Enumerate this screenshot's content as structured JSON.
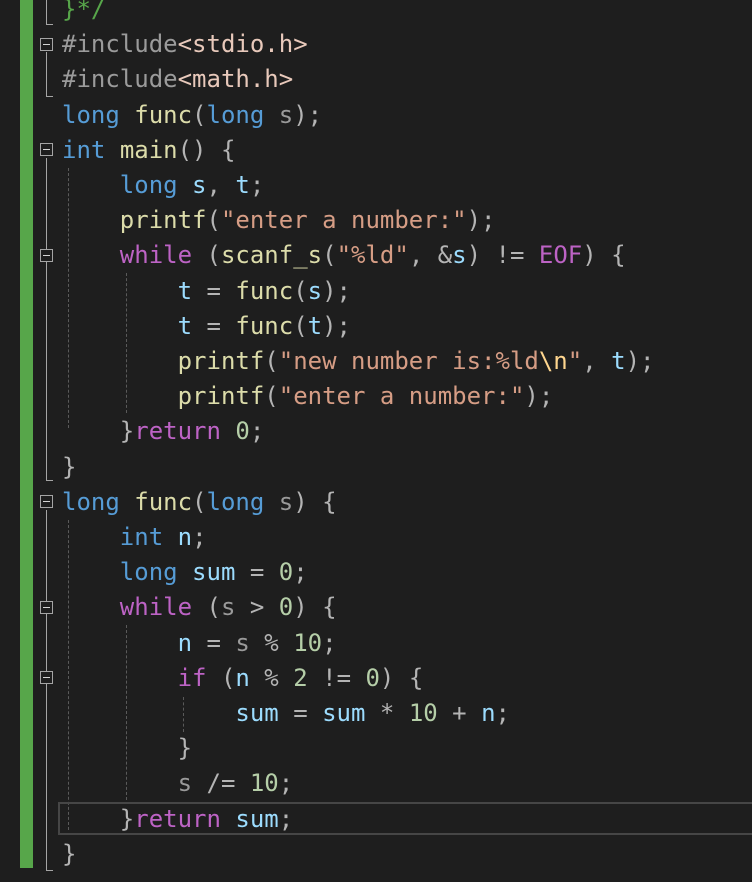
{
  "editor": {
    "lines": [
      [
        {
          "t": "}*/",
          "c": "cm"
        }
      ],
      [
        {
          "t": "#include",
          "c": "pp"
        },
        {
          "t": "<stdio.h>",
          "c": "hdr"
        }
      ],
      [
        {
          "t": "#include",
          "c": "pp"
        },
        {
          "t": "<math.h>",
          "c": "hdr"
        }
      ],
      [
        {
          "t": "long",
          "c": "kw"
        },
        {
          "t": " "
        },
        {
          "t": "func",
          "c": "fn"
        },
        {
          "t": "(",
          "c": "op"
        },
        {
          "t": "long",
          "c": "kw"
        },
        {
          "t": " "
        },
        {
          "t": "s",
          "c": "prm"
        },
        {
          "t": ");",
          "c": "op"
        }
      ],
      [
        {
          "t": "int",
          "c": "kw"
        },
        {
          "t": " "
        },
        {
          "t": "main",
          "c": "fn"
        },
        {
          "t": "() {",
          "c": "op"
        }
      ],
      [
        {
          "t": "    "
        },
        {
          "t": "long",
          "c": "kw"
        },
        {
          "t": " "
        },
        {
          "t": "s",
          "c": "var"
        },
        {
          "t": ", ",
          "c": "op"
        },
        {
          "t": "t",
          "c": "var"
        },
        {
          "t": ";",
          "c": "op"
        }
      ],
      [
        {
          "t": "    "
        },
        {
          "t": "printf",
          "c": "fn"
        },
        {
          "t": "(",
          "c": "op"
        },
        {
          "t": "\"enter a number:\"",
          "c": "str"
        },
        {
          "t": ");",
          "c": "op"
        }
      ],
      [
        {
          "t": "    "
        },
        {
          "t": "while",
          "c": "mac"
        },
        {
          "t": " (",
          "c": "op"
        },
        {
          "t": "scanf_s",
          "c": "fn"
        },
        {
          "t": "(",
          "c": "op"
        },
        {
          "t": "\"%ld\"",
          "c": "str"
        },
        {
          "t": ", &",
          "c": "op"
        },
        {
          "t": "s",
          "c": "var"
        },
        {
          "t": ") != ",
          "c": "op"
        },
        {
          "t": "EOF",
          "c": "mac"
        },
        {
          "t": ") {",
          "c": "op"
        }
      ],
      [
        {
          "t": "        "
        },
        {
          "t": "t",
          "c": "var"
        },
        {
          "t": " = ",
          "c": "op"
        },
        {
          "t": "func",
          "c": "fn"
        },
        {
          "t": "(",
          "c": "op"
        },
        {
          "t": "s",
          "c": "var"
        },
        {
          "t": ");",
          "c": "op"
        }
      ],
      [
        {
          "t": "        "
        },
        {
          "t": "t",
          "c": "var"
        },
        {
          "t": " = ",
          "c": "op"
        },
        {
          "t": "func",
          "c": "fn"
        },
        {
          "t": "(",
          "c": "op"
        },
        {
          "t": "t",
          "c": "var"
        },
        {
          "t": ");",
          "c": "op"
        }
      ],
      [
        {
          "t": "        "
        },
        {
          "t": "printf",
          "c": "fn"
        },
        {
          "t": "(",
          "c": "op"
        },
        {
          "t": "\"new number is:%ld",
          "c": "str"
        },
        {
          "t": "\\n",
          "c": "esc"
        },
        {
          "t": "\"",
          "c": "str"
        },
        {
          "t": ", ",
          "c": "op"
        },
        {
          "t": "t",
          "c": "var"
        },
        {
          "t": ");",
          "c": "op"
        }
      ],
      [
        {
          "t": "        "
        },
        {
          "t": "printf",
          "c": "fn"
        },
        {
          "t": "(",
          "c": "op"
        },
        {
          "t": "\"enter a number:\"",
          "c": "str"
        },
        {
          "t": ");",
          "c": "op"
        }
      ],
      [
        {
          "t": "    "
        },
        {
          "t": "}",
          "c": "op"
        },
        {
          "t": "return",
          "c": "mac"
        },
        {
          "t": " "
        },
        {
          "t": "0",
          "c": "num"
        },
        {
          "t": ";",
          "c": "op"
        }
      ],
      [
        {
          "t": "}",
          "c": "op"
        }
      ],
      [
        {
          "t": "long",
          "c": "kw"
        },
        {
          "t": " "
        },
        {
          "t": "func",
          "c": "fn"
        },
        {
          "t": "(",
          "c": "op"
        },
        {
          "t": "long",
          "c": "kw"
        },
        {
          "t": " "
        },
        {
          "t": "s",
          "c": "prm"
        },
        {
          "t": ") {",
          "c": "op"
        }
      ],
      [
        {
          "t": "    "
        },
        {
          "t": "int",
          "c": "kw"
        },
        {
          "t": " "
        },
        {
          "t": "n",
          "c": "var"
        },
        {
          "t": ";",
          "c": "op"
        }
      ],
      [
        {
          "t": "    "
        },
        {
          "t": "long",
          "c": "kw"
        },
        {
          "t": " "
        },
        {
          "t": "sum",
          "c": "var"
        },
        {
          "t": " = ",
          "c": "op"
        },
        {
          "t": "0",
          "c": "num"
        },
        {
          "t": ";",
          "c": "op"
        }
      ],
      [
        {
          "t": "    "
        },
        {
          "t": "while",
          "c": "mac"
        },
        {
          "t": " (",
          "c": "op"
        },
        {
          "t": "s",
          "c": "prm"
        },
        {
          "t": " > ",
          "c": "op"
        },
        {
          "t": "0",
          "c": "num"
        },
        {
          "t": ") {",
          "c": "op"
        }
      ],
      [
        {
          "t": "        "
        },
        {
          "t": "n",
          "c": "var"
        },
        {
          "t": " = ",
          "c": "op"
        },
        {
          "t": "s",
          "c": "prm"
        },
        {
          "t": " % ",
          "c": "op"
        },
        {
          "t": "10",
          "c": "num"
        },
        {
          "t": ";",
          "c": "op"
        }
      ],
      [
        {
          "t": "        "
        },
        {
          "t": "if",
          "c": "mac"
        },
        {
          "t": " (",
          "c": "op"
        },
        {
          "t": "n",
          "c": "var"
        },
        {
          "t": " % ",
          "c": "op"
        },
        {
          "t": "2",
          "c": "num"
        },
        {
          "t": " != ",
          "c": "op"
        },
        {
          "t": "0",
          "c": "num"
        },
        {
          "t": ") {",
          "c": "op"
        }
      ],
      [
        {
          "t": "            "
        },
        {
          "t": "sum",
          "c": "var"
        },
        {
          "t": " = ",
          "c": "op"
        },
        {
          "t": "sum",
          "c": "var"
        },
        {
          "t": " * ",
          "c": "op"
        },
        {
          "t": "10",
          "c": "num"
        },
        {
          "t": " + ",
          "c": "op"
        },
        {
          "t": "n",
          "c": "var"
        },
        {
          "t": ";",
          "c": "op"
        }
      ],
      [
        {
          "t": "        "
        },
        {
          "t": "}",
          "c": "op"
        }
      ],
      [
        {
          "t": "        "
        },
        {
          "t": "s",
          "c": "prm"
        },
        {
          "t": " /= ",
          "c": "op"
        },
        {
          "t": "10",
          "c": "num"
        },
        {
          "t": ";",
          "c": "op"
        }
      ],
      [
        {
          "t": "    "
        },
        {
          "t": "}",
          "c": "op"
        },
        {
          "t": "return",
          "c": "mac"
        },
        {
          "t": " "
        },
        {
          "t": "sum",
          "c": "var"
        },
        {
          "t": ";",
          "c": "op"
        }
      ],
      [
        {
          "t": "}",
          "c": "op"
        }
      ]
    ]
  },
  "colors": {
    "background": "#1e1e1e",
    "change_bar": "#57a64a",
    "keyword": "#569cd6",
    "function": "#dcdcaa",
    "variable": "#9cdcfe",
    "number": "#b5cea8",
    "string": "#d69d85",
    "macro": "#bd63c5",
    "comment": "#57a64a"
  }
}
